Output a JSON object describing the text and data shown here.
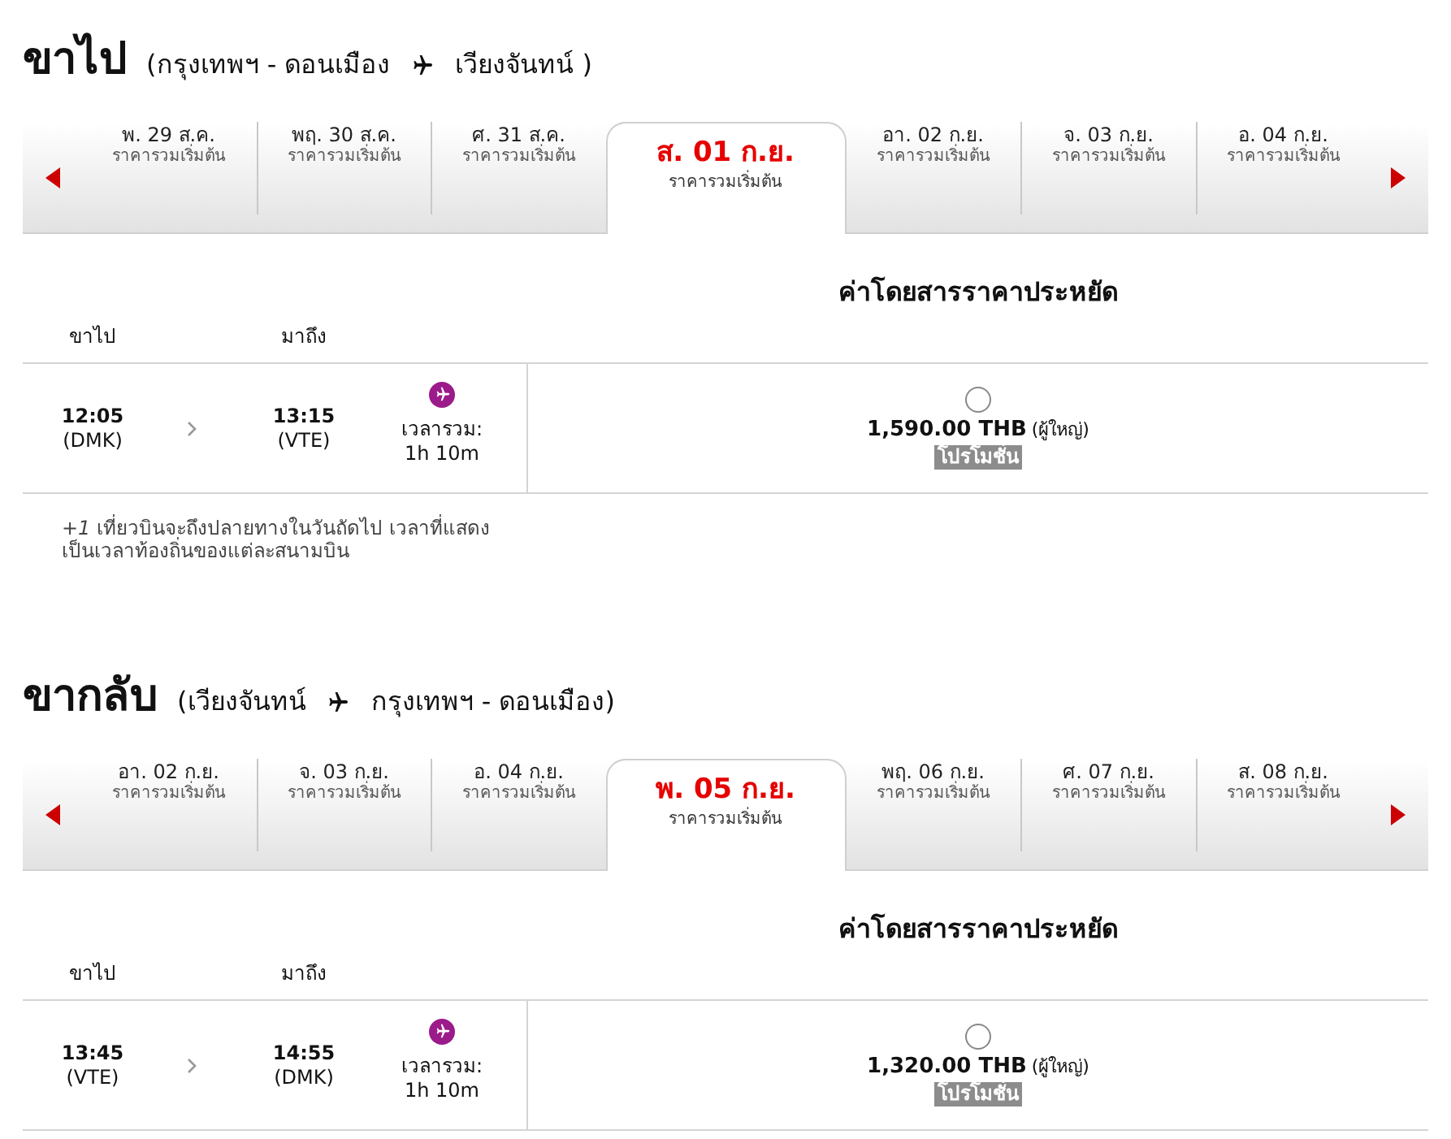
{
  "sections": [
    {
      "title": "ขาไป",
      "route": {
        "open": "(",
        "from": "กรุงเทพฯ - ดอนเมือง",
        "to": "เวียงจันทน์",
        "close": " )"
      },
      "dates": [
        {
          "label": "พ. 29 ส.ค.",
          "sub": "ราคารวมเริ่มต้น",
          "selected": false
        },
        {
          "label": "พฤ. 30 ส.ค.",
          "sub": "ราคารวมเริ่มต้น",
          "selected": false
        },
        {
          "label": "ศ. 31 ส.ค.",
          "sub": "ราคารวมเริ่มต้น",
          "selected": false
        },
        {
          "label": "ส. 01 ก.ย.",
          "sub": "ราคารวมเริ่มต้น",
          "selected": true
        },
        {
          "label": "อา. 02 ก.ย.",
          "sub": "ราคารวมเริ่มต้น",
          "selected": false
        },
        {
          "label": "จ. 03 ก.ย.",
          "sub": "ราคารวมเริ่มต้น",
          "selected": false
        },
        {
          "label": "อ. 04 ก.ย.",
          "sub": "ราคารวมเริ่มต้น",
          "selected": false
        }
      ],
      "fare_header": "ค่าโดยสารราคาประหยัด",
      "columns": [
        "ขาไป",
        "มาถึง"
      ],
      "flight": {
        "depart_time": "12:05",
        "depart_code": "(DMK)",
        "arrive_time": "13:15",
        "arrive_code": "(VTE)",
        "duration": "เวลารวม: 1h 10m",
        "price": "1,590.00 THB",
        "passenger": "(ผู้ใหญ่)",
        "badge": "โปรโมชั่น",
        "selected": false
      },
      "note": "*+1* เที่ยวบินจะถึงปลายทางในวันถัดไป เวลาที่แสดงเป็นเวลาท้องถิ่นของแต่ละสนามบิน"
    },
    {
      "title": "ขากลับ",
      "route": {
        "open": "(",
        "from": "เวียงจันทน์",
        "to": "กรุงเทพฯ - ดอนเมือง",
        "close": ")"
      },
      "dates": [
        {
          "label": "อา. 02 ก.ย.",
          "sub": "ราคารวมเริ่มต้น",
          "selected": false
        },
        {
          "label": "จ. 03 ก.ย.",
          "sub": "ราคารวมเริ่มต้น",
          "selected": false
        },
        {
          "label": "อ. 04 ก.ย.",
          "sub": "ราคารวมเริ่มต้น",
          "selected": false
        },
        {
          "label": "พ. 05 ก.ย.",
          "sub": "ราคารวมเริ่มต้น",
          "selected": true
        },
        {
          "label": "พฤ. 06 ก.ย.",
          "sub": "ราคารวมเริ่มต้น",
          "selected": false
        },
        {
          "label": "ศ. 07 ก.ย.",
          "sub": "ราคารวมเริ่มต้น",
          "selected": false
        },
        {
          "label": "ส. 08 ก.ย.",
          "sub": "ราคารวมเริ่มต้น",
          "selected": false
        }
      ],
      "fare_header": "ค่าโดยสารราคาประหยัด",
      "columns": [
        "ขาไป",
        "มาถึง"
      ],
      "flight": {
        "depart_time": "13:45",
        "depart_code": "(VTE)",
        "arrive_time": "14:55",
        "arrive_code": "(DMK)",
        "duration": "เวลารวม: 1h 10m",
        "price": "1,320.00 THB",
        "passenger": "(ผู้ใหญ่)",
        "badge": "โปรโมชั่น",
        "selected": false
      }
    }
  ]
}
